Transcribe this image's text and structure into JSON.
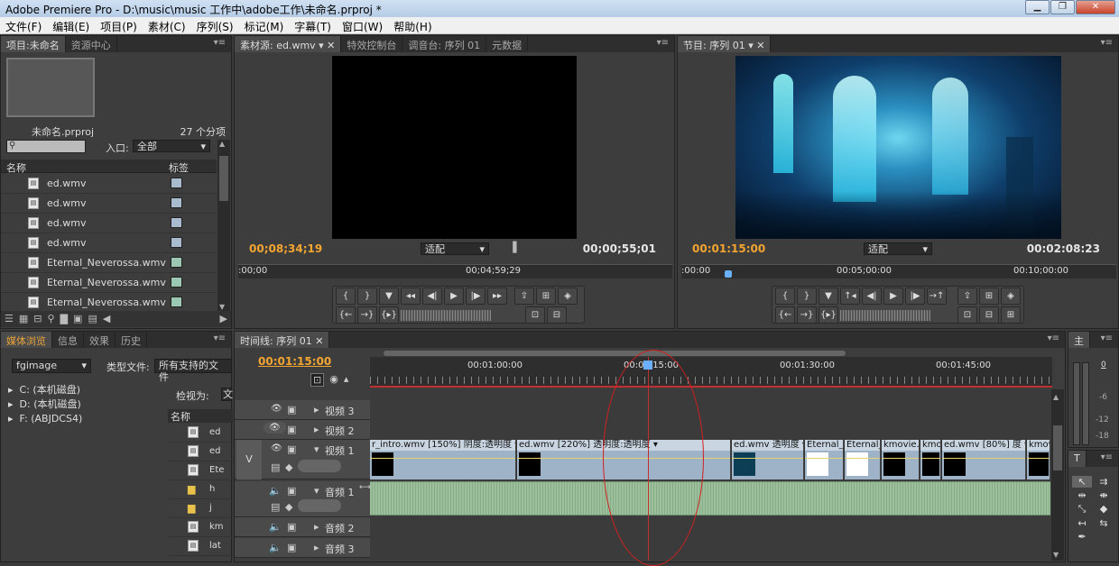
{
  "window": {
    "title": "Adobe Premiere Pro - D:\\music\\music 工作中\\adobe工作\\未命名.prproj *"
  },
  "menu": [
    "文件(F)",
    "编辑(E)",
    "项目(P)",
    "素材(C)",
    "序列(S)",
    "标记(M)",
    "字幕(T)",
    "窗口(W)",
    "帮助(H)"
  ],
  "project": {
    "tabs": [
      "项目:未命名",
      "资源中心"
    ],
    "filename": "未命名.prproj",
    "count": "27 个分项",
    "in_label": "入口:",
    "in_value": "全部",
    "col_name": "名称",
    "col_label": "标签",
    "items": [
      {
        "name": "ed.wmv",
        "color": "#a9bccf"
      },
      {
        "name": "ed.wmv",
        "color": "#a9bccf"
      },
      {
        "name": "ed.wmv",
        "color": "#a9bccf"
      },
      {
        "name": "ed.wmv",
        "color": "#a9bccf"
      },
      {
        "name": "Eternal_Neverossa.wmv",
        "color": "#9bc7b3"
      },
      {
        "name": "Eternal_Neverossa.wmv",
        "color": "#9bc7b3"
      },
      {
        "name": "Eternal_Neverossa.wmv",
        "color": "#9bc7b3"
      }
    ]
  },
  "source": {
    "tabs": [
      "素材源: ed.wmv",
      "特效控制台",
      "调音台: 序列 01",
      "元数据"
    ],
    "timecode": "00;08;34;19",
    "fit": "适配",
    "duration": "00;00;55;01",
    "ruler_start": ":00;00",
    "ruler_mid": "00;04;59;29"
  },
  "program": {
    "tab": "节目: 序列 01",
    "timecode": "00:01:15:00",
    "fit": "适配",
    "duration": "00:02:08:23",
    "ruler_start": ":00:00",
    "ruler_mid": "00:05;00:00",
    "ruler_end": "00:10;00:00"
  },
  "media": {
    "tabs": [
      "媒体浏览",
      "信息",
      "效果",
      "历史"
    ],
    "folder": "fgimage",
    "type_label": "类型文件:",
    "type_value": "所有支持的文件",
    "view_label": "检视为:",
    "view_value": "文",
    "col_name": "名称",
    "drives": [
      "C: (本机磁盘)",
      "D: (本机磁盘)",
      "F: (ABJDCS4)"
    ],
    "files": [
      "ed",
      "ed",
      "Ete",
      "h",
      "j",
      "km",
      "lat"
    ]
  },
  "timeline": {
    "tab": "时间线: 序列 01",
    "timecode": "00:01:15:00",
    "marks": [
      "00:01:00:00",
      "00:01:15:00",
      "00:01:30:00",
      "00:01:45:00"
    ],
    "tracks": [
      "视频 3",
      "视频 2",
      "视频 1",
      "音频 1",
      "音频 2",
      "音频 3"
    ],
    "v_label": "V",
    "clips": [
      {
        "text": "r_intro.wmv [150%] 阴度:透明度 ▾"
      },
      {
        "text": "ed.wmv [220%] 透明度:透明度 ▾"
      },
      {
        "text": "ed.wmv 透明度 ▾"
      },
      {
        "text": "Eternal_"
      },
      {
        "text": "Eternal_"
      },
      {
        "text": "kmovie.v"
      },
      {
        "text": "kmo"
      },
      {
        "text": "ed.wmv [80%] 度 ▾"
      },
      {
        "text": "kmov"
      }
    ]
  },
  "audio_meter": {
    "tab": "主",
    "levels": [
      "0",
      "-6",
      "-12",
      "-18"
    ]
  },
  "tools": {
    "tab": "T"
  }
}
